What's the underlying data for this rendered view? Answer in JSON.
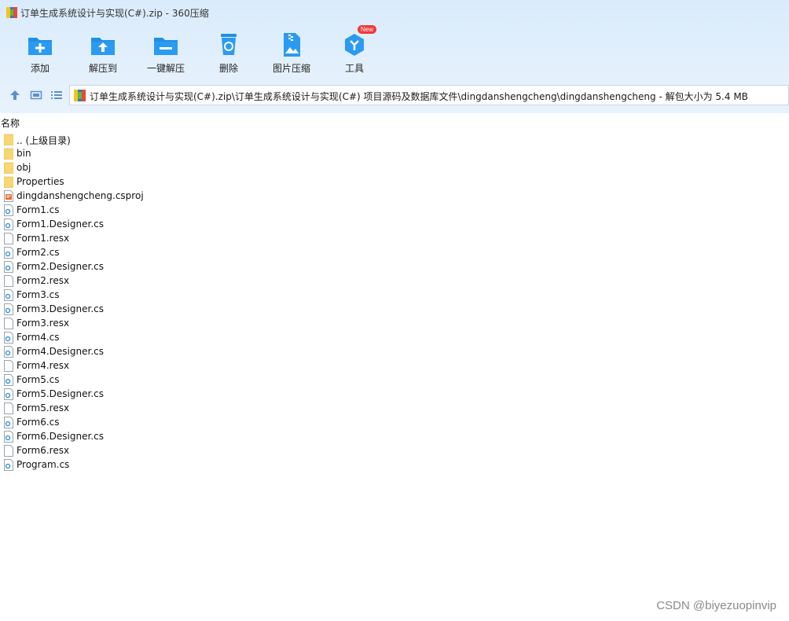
{
  "window": {
    "title": "订单生成系统设计与实现(C#).zip - 360压缩"
  },
  "toolbar": {
    "add": "添加",
    "extract_to": "解压到",
    "one_click_extract": "一键解压",
    "delete": "删除",
    "image_compress": "图片压缩",
    "tools": "工具",
    "new_badge": "New"
  },
  "address": {
    "path": "订单生成系统设计与实现(C#).zip\\订单生成系统设计与实现(C#) 项目源码及数据库文件\\dingdanshengcheng\\dingdanshengcheng - 解包大小为 5.4 MB"
  },
  "columns": {
    "name": "名称"
  },
  "files": [
    {
      "name": ".. (上级目录)",
      "type": "folder"
    },
    {
      "name": "bin",
      "type": "folder"
    },
    {
      "name": "obj",
      "type": "folder"
    },
    {
      "name": "Properties",
      "type": "folder"
    },
    {
      "name": "dingdanshengcheng.csproj",
      "type": "csproj"
    },
    {
      "name": "Form1.cs",
      "type": "cs"
    },
    {
      "name": "Form1.Designer.cs",
      "type": "cs"
    },
    {
      "name": "Form1.resx",
      "type": "resx"
    },
    {
      "name": "Form2.cs",
      "type": "cs"
    },
    {
      "name": "Form2.Designer.cs",
      "type": "cs"
    },
    {
      "name": "Form2.resx",
      "type": "resx"
    },
    {
      "name": "Form3.cs",
      "type": "cs"
    },
    {
      "name": "Form3.Designer.cs",
      "type": "cs"
    },
    {
      "name": "Form3.resx",
      "type": "resx"
    },
    {
      "name": "Form4.cs",
      "type": "cs"
    },
    {
      "name": "Form4.Designer.cs",
      "type": "cs"
    },
    {
      "name": "Form4.resx",
      "type": "resx"
    },
    {
      "name": "Form5.cs",
      "type": "cs"
    },
    {
      "name": "Form5.Designer.cs",
      "type": "cs"
    },
    {
      "name": "Form5.resx",
      "type": "resx"
    },
    {
      "name": "Form6.cs",
      "type": "cs"
    },
    {
      "name": "Form6.Designer.cs",
      "type": "cs"
    },
    {
      "name": "Form6.resx",
      "type": "resx"
    },
    {
      "name": "Program.cs",
      "type": "cs"
    }
  ],
  "watermark": "CSDN @biyezuopinvip",
  "colors": {
    "accent": "#1f8fe8",
    "top_bg": "#dcecfb",
    "folder": "#f7d774",
    "badge": "#f03a3a"
  }
}
